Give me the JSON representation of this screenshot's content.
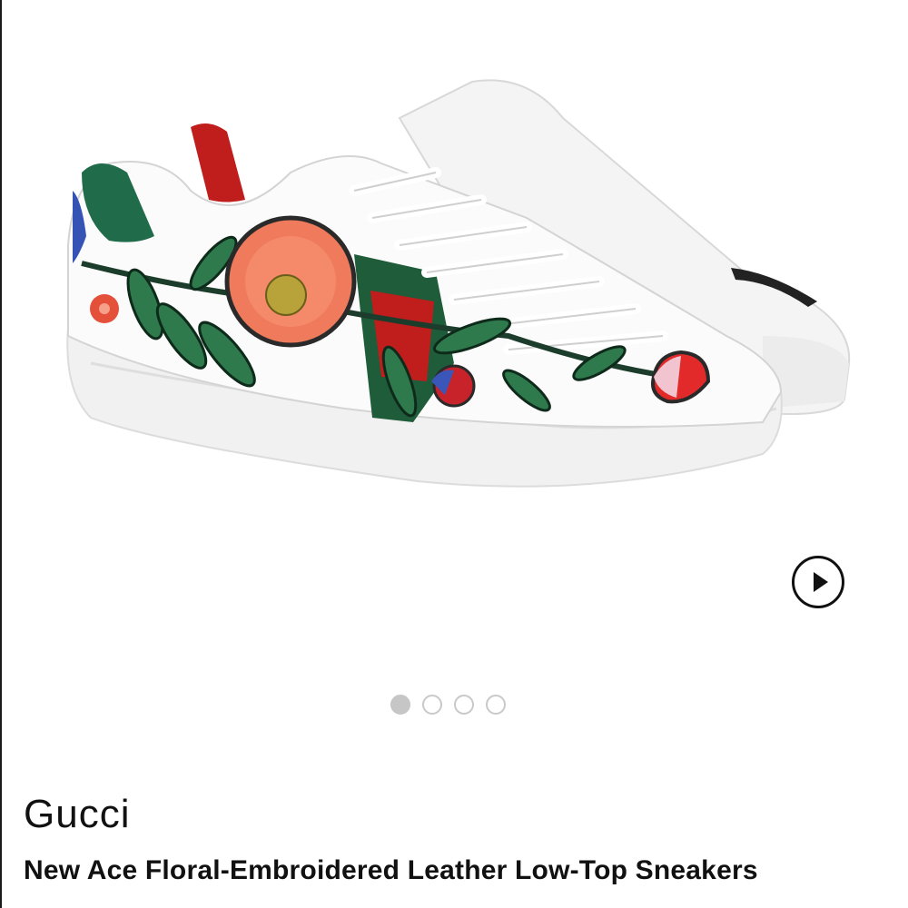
{
  "product": {
    "brand": "Gucci",
    "name": "New Ace Floral-Embroidered Leather Low-Top Sneakers",
    "image_icon": "sneaker-product-image"
  },
  "gallery": {
    "slide_count": 4,
    "active_index": 0,
    "video_button_icon": "play-icon"
  },
  "colors": {
    "text": "#111111",
    "dot_active": "#c6c6c6",
    "dot_inactive_border": "#c9c9c9",
    "stripe_green": "#1f5c3a",
    "stripe_red": "#c01d1d"
  }
}
